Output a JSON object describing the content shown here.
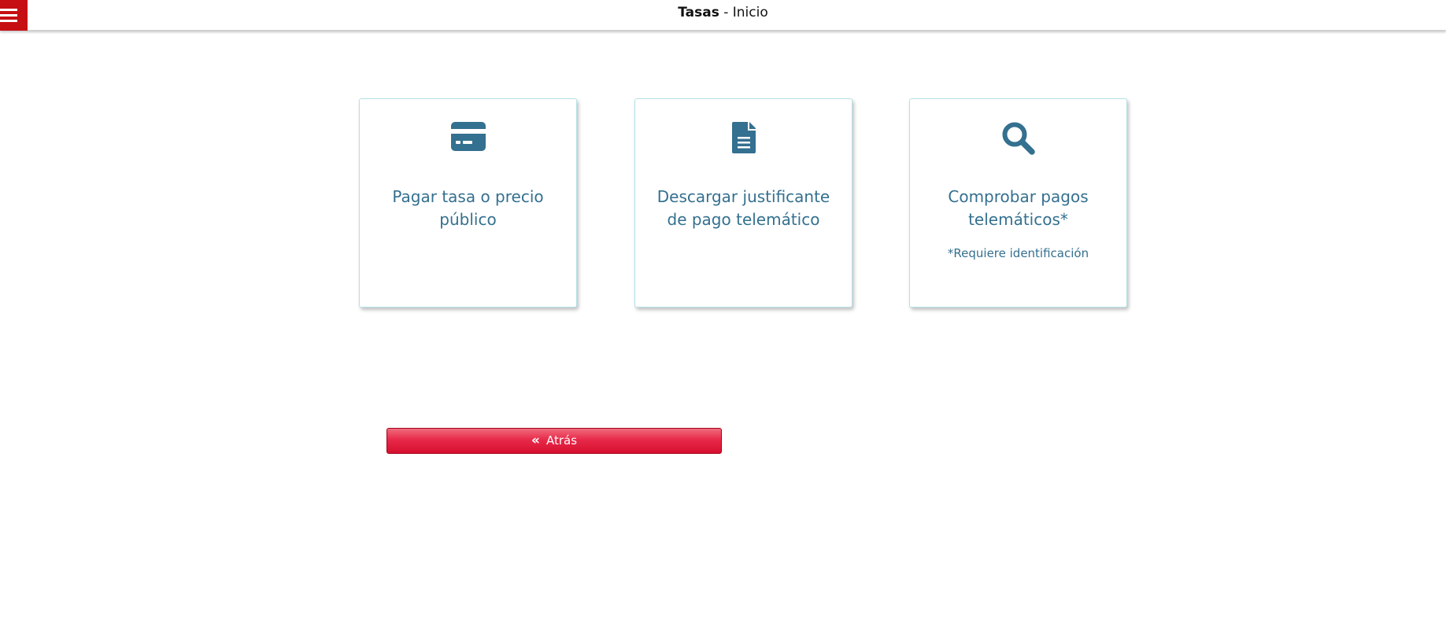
{
  "header": {
    "title_strong": "Tasas",
    "title_rest": " - Inicio"
  },
  "cards": [
    {
      "id": "pay",
      "icon": "credit-card-icon",
      "title": "Pagar tasa o precio público",
      "note": ""
    },
    {
      "id": "download",
      "icon": "document-icon",
      "title": "Descargar justificante de pago telemático",
      "note": ""
    },
    {
      "id": "check",
      "icon": "search-icon",
      "title": "Comprobar pagos telemáticos*",
      "note": "*Requiere identificación"
    }
  ],
  "back_button": {
    "icon": "double-chevron-left-icon",
    "label": "Atrás"
  },
  "colors": {
    "brand_red": "#c60f13",
    "card_text": "#34708f",
    "card_border": "#b5e1e6",
    "button_red": "#e8294a"
  }
}
